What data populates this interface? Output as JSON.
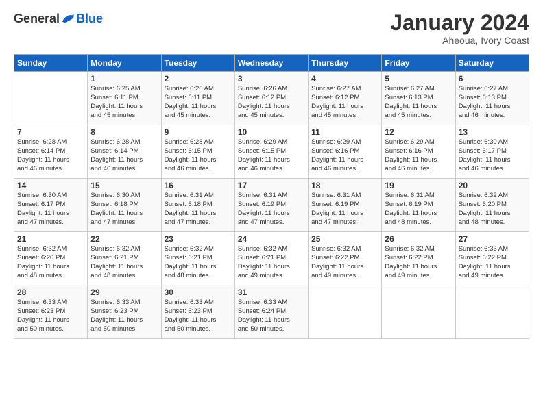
{
  "logo": {
    "general": "General",
    "blue": "Blue"
  },
  "title": "January 2024",
  "subtitle": "Aheoua, Ivory Coast",
  "header_days": [
    "Sunday",
    "Monday",
    "Tuesday",
    "Wednesday",
    "Thursday",
    "Friday",
    "Saturday"
  ],
  "weeks": [
    [
      {
        "day": "",
        "content": ""
      },
      {
        "day": "1",
        "content": "Sunrise: 6:25 AM\nSunset: 6:11 PM\nDaylight: 11 hours\nand 45 minutes."
      },
      {
        "day": "2",
        "content": "Sunrise: 6:26 AM\nSunset: 6:11 PM\nDaylight: 11 hours\nand 45 minutes."
      },
      {
        "day": "3",
        "content": "Sunrise: 6:26 AM\nSunset: 6:12 PM\nDaylight: 11 hours\nand 45 minutes."
      },
      {
        "day": "4",
        "content": "Sunrise: 6:27 AM\nSunset: 6:12 PM\nDaylight: 11 hours\nand 45 minutes."
      },
      {
        "day": "5",
        "content": "Sunrise: 6:27 AM\nSunset: 6:13 PM\nDaylight: 11 hours\nand 45 minutes."
      },
      {
        "day": "6",
        "content": "Sunrise: 6:27 AM\nSunset: 6:13 PM\nDaylight: 11 hours\nand 46 minutes."
      }
    ],
    [
      {
        "day": "7",
        "content": "Sunrise: 6:28 AM\nSunset: 6:14 PM\nDaylight: 11 hours\nand 46 minutes."
      },
      {
        "day": "8",
        "content": "Sunrise: 6:28 AM\nSunset: 6:14 PM\nDaylight: 11 hours\nand 46 minutes."
      },
      {
        "day": "9",
        "content": "Sunrise: 6:28 AM\nSunset: 6:15 PM\nDaylight: 11 hours\nand 46 minutes."
      },
      {
        "day": "10",
        "content": "Sunrise: 6:29 AM\nSunset: 6:15 PM\nDaylight: 11 hours\nand 46 minutes."
      },
      {
        "day": "11",
        "content": "Sunrise: 6:29 AM\nSunset: 6:16 PM\nDaylight: 11 hours\nand 46 minutes."
      },
      {
        "day": "12",
        "content": "Sunrise: 6:29 AM\nSunset: 6:16 PM\nDaylight: 11 hours\nand 46 minutes."
      },
      {
        "day": "13",
        "content": "Sunrise: 6:30 AM\nSunset: 6:17 PM\nDaylight: 11 hours\nand 46 minutes."
      }
    ],
    [
      {
        "day": "14",
        "content": "Sunrise: 6:30 AM\nSunset: 6:17 PM\nDaylight: 11 hours\nand 47 minutes."
      },
      {
        "day": "15",
        "content": "Sunrise: 6:30 AM\nSunset: 6:18 PM\nDaylight: 11 hours\nand 47 minutes."
      },
      {
        "day": "16",
        "content": "Sunrise: 6:31 AM\nSunset: 6:18 PM\nDaylight: 11 hours\nand 47 minutes."
      },
      {
        "day": "17",
        "content": "Sunrise: 6:31 AM\nSunset: 6:19 PM\nDaylight: 11 hours\nand 47 minutes."
      },
      {
        "day": "18",
        "content": "Sunrise: 6:31 AM\nSunset: 6:19 PM\nDaylight: 11 hours\nand 47 minutes."
      },
      {
        "day": "19",
        "content": "Sunrise: 6:31 AM\nSunset: 6:19 PM\nDaylight: 11 hours\nand 48 minutes."
      },
      {
        "day": "20",
        "content": "Sunrise: 6:32 AM\nSunset: 6:20 PM\nDaylight: 11 hours\nand 48 minutes."
      }
    ],
    [
      {
        "day": "21",
        "content": "Sunrise: 6:32 AM\nSunset: 6:20 PM\nDaylight: 11 hours\nand 48 minutes."
      },
      {
        "day": "22",
        "content": "Sunrise: 6:32 AM\nSunset: 6:21 PM\nDaylight: 11 hours\nand 48 minutes."
      },
      {
        "day": "23",
        "content": "Sunrise: 6:32 AM\nSunset: 6:21 PM\nDaylight: 11 hours\nand 48 minutes."
      },
      {
        "day": "24",
        "content": "Sunrise: 6:32 AM\nSunset: 6:21 PM\nDaylight: 11 hours\nand 49 minutes."
      },
      {
        "day": "25",
        "content": "Sunrise: 6:32 AM\nSunset: 6:22 PM\nDaylight: 11 hours\nand 49 minutes."
      },
      {
        "day": "26",
        "content": "Sunrise: 6:32 AM\nSunset: 6:22 PM\nDaylight: 11 hours\nand 49 minutes."
      },
      {
        "day": "27",
        "content": "Sunrise: 6:33 AM\nSunset: 6:22 PM\nDaylight: 11 hours\nand 49 minutes."
      }
    ],
    [
      {
        "day": "28",
        "content": "Sunrise: 6:33 AM\nSunset: 6:23 PM\nDaylight: 11 hours\nand 50 minutes."
      },
      {
        "day": "29",
        "content": "Sunrise: 6:33 AM\nSunset: 6:23 PM\nDaylight: 11 hours\nand 50 minutes."
      },
      {
        "day": "30",
        "content": "Sunrise: 6:33 AM\nSunset: 6:23 PM\nDaylight: 11 hours\nand 50 minutes."
      },
      {
        "day": "31",
        "content": "Sunrise: 6:33 AM\nSunset: 6:24 PM\nDaylight: 11 hours\nand 50 minutes."
      },
      {
        "day": "",
        "content": ""
      },
      {
        "day": "",
        "content": ""
      },
      {
        "day": "",
        "content": ""
      }
    ]
  ]
}
